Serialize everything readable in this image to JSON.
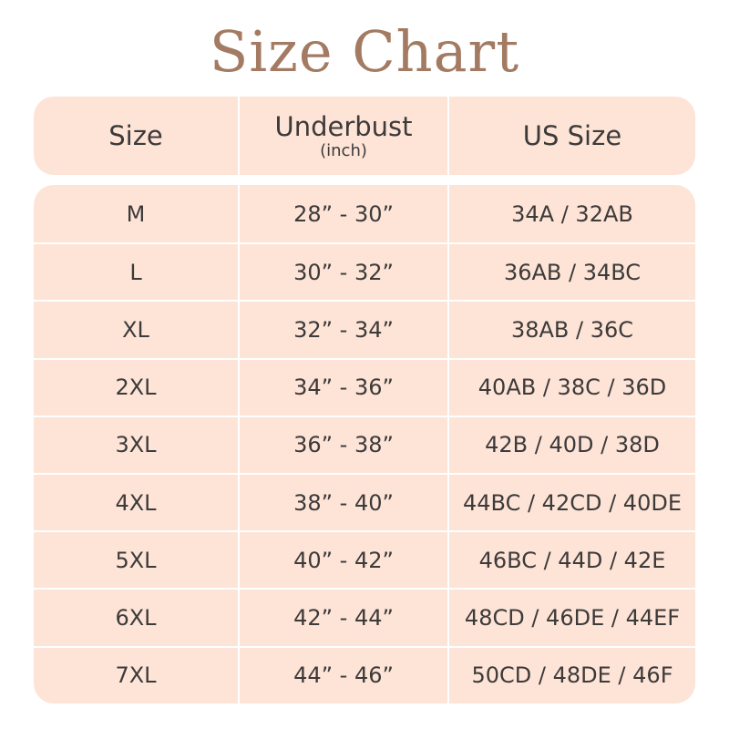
{
  "title": "Size Chart",
  "header": {
    "size": "Size",
    "underbust": "Underbust",
    "underbust_unit": "(inch)",
    "us_size": "US Size"
  },
  "rows": [
    {
      "size": "M",
      "underbust": "28” - 30”",
      "us_size": "34A / 32AB"
    },
    {
      "size": "L",
      "underbust": "30” - 32”",
      "us_size": "36AB / 34BC"
    },
    {
      "size": "XL",
      "underbust": "32” - 34”",
      "us_size": "38AB / 36C"
    },
    {
      "size": "2XL",
      "underbust": "34” - 36”",
      "us_size": "40AB / 38C / 36D"
    },
    {
      "size": "3XL",
      "underbust": "36” - 38”",
      "us_size": "42B / 40D / 38D"
    },
    {
      "size": "4XL",
      "underbust": "38” - 40”",
      "us_size": "44BC / 42CD / 40DE"
    },
    {
      "size": "5XL",
      "underbust": "40” - 42”",
      "us_size": "46BC / 44D / 42E"
    },
    {
      "size": "6XL",
      "underbust": "42” - 44”",
      "us_size": "48CD / 46DE / 44EF"
    },
    {
      "size": "7XL",
      "underbust": "44” - 46”",
      "us_size": "50CD / 48DE / 46F"
    }
  ],
  "colors": {
    "title": "#a37a62",
    "table_fill": "#fde4d7",
    "text": "#3d3a3a",
    "divider": "#ffffff"
  }
}
